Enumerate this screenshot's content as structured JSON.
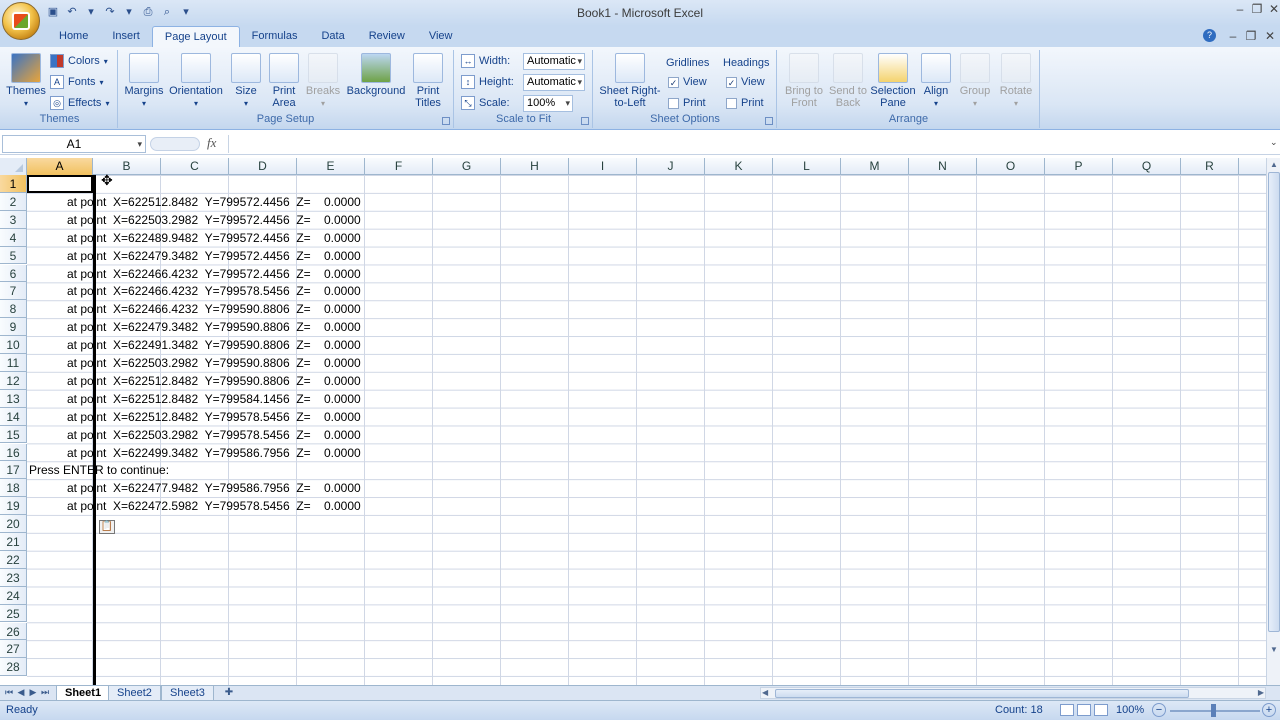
{
  "window": {
    "title": "Book1 - Microsoft Excel"
  },
  "quick_access": [
    {
      "icon": "save-icon",
      "glyph": "▣"
    },
    {
      "icon": "undo-icon",
      "glyph": "↶"
    },
    {
      "icon": "undo-dropdown-icon",
      "glyph": "▾"
    },
    {
      "icon": "redo-icon",
      "glyph": "↷"
    },
    {
      "icon": "redo-dropdown-icon",
      "glyph": "▾"
    },
    {
      "icon": "print-icon",
      "glyph": "⎙"
    },
    {
      "icon": "print-preview-icon",
      "glyph": "⌕"
    },
    {
      "icon": "customize-qat-icon",
      "glyph": "▾"
    }
  ],
  "tabs": [
    "Home",
    "Insert",
    "Page Layout",
    "Formulas",
    "Data",
    "Review",
    "View"
  ],
  "active_tab": "Page Layout",
  "ribbon": {
    "themes": {
      "label": "Themes",
      "themes_btn": "Themes",
      "colors": "Colors",
      "fonts": "Fonts",
      "effects": "Effects"
    },
    "page_setup": {
      "label": "Page Setup",
      "margins": "Margins",
      "orientation": "Orientation",
      "size": "Size",
      "print_area": "Print Area",
      "breaks": "Breaks",
      "background": "Background",
      "print_titles": "Print Titles"
    },
    "scale_to_fit": {
      "label": "Scale to Fit",
      "width_label": "Width:",
      "width_value": "Automatic",
      "height_label": "Height:",
      "height_value": "Automatic",
      "scale_label": "Scale:",
      "scale_value": "100%"
    },
    "sheet_options": {
      "label": "Sheet Options",
      "sheet_rtl": "Sheet Right-to-Left",
      "gridlines": "Gridlines",
      "headings": "Headings",
      "view": "View",
      "print": "Print"
    },
    "arrange": {
      "label": "Arrange",
      "bring_to_front": "Bring to Front",
      "send_to_back": "Send to Back",
      "selection_pane": "Selection Pane",
      "align": "Align",
      "group": "Group",
      "rotate": "Rotate"
    }
  },
  "formula_bar": {
    "name_box": "A1",
    "fx": "fx",
    "value": ""
  },
  "columns": [
    "A",
    "B",
    "C",
    "D",
    "E",
    "F",
    "G",
    "H",
    "I",
    "J",
    "K",
    "L",
    "M",
    "N",
    "O",
    "P",
    "Q",
    "R"
  ],
  "rows": [
    "1",
    "2",
    "3",
    "4",
    "5",
    "6",
    "7",
    "8",
    "9",
    "10",
    "11",
    "12",
    "13",
    "14",
    "15",
    "16",
    "17",
    "18",
    "19",
    "20",
    "21",
    "22",
    "23",
    "24",
    "25",
    "26",
    "27",
    "28"
  ],
  "selected_cell": {
    "col": "A",
    "row": "1"
  },
  "cell_lines": [
    {
      "row": 2,
      "text": "at point  X=622512.8482  Y=799572.4456  Z=    0.0000"
    },
    {
      "row": 3,
      "text": "at point  X=622503.2982  Y=799572.4456  Z=    0.0000"
    },
    {
      "row": 4,
      "text": "at point  X=622489.9482  Y=799572.4456  Z=    0.0000"
    },
    {
      "row": 5,
      "text": "at point  X=622479.3482  Y=799572.4456  Z=    0.0000"
    },
    {
      "row": 6,
      "text": "at point  X=622466.4232  Y=799572.4456  Z=    0.0000"
    },
    {
      "row": 7,
      "text": "at point  X=622466.4232  Y=799578.5456  Z=    0.0000"
    },
    {
      "row": 8,
      "text": "at point  X=622466.4232  Y=799590.8806  Z=    0.0000"
    },
    {
      "row": 9,
      "text": "at point  X=622479.3482  Y=799590.8806  Z=    0.0000"
    },
    {
      "row": 10,
      "text": "at point  X=622491.3482  Y=799590.8806  Z=    0.0000"
    },
    {
      "row": 11,
      "text": "at point  X=622503.2982  Y=799590.8806  Z=    0.0000"
    },
    {
      "row": 12,
      "text": "at point  X=622512.8482  Y=799590.8806  Z=    0.0000"
    },
    {
      "row": 13,
      "text": "at point  X=622512.8482  Y=799584.1456  Z=    0.0000"
    },
    {
      "row": 14,
      "text": "at point  X=622512.8482  Y=799578.5456  Z=    0.0000"
    },
    {
      "row": 15,
      "text": "at point  X=622503.2982  Y=799578.5456  Z=    0.0000"
    },
    {
      "row": 16,
      "text": "at point  X=622499.3482  Y=799586.7956  Z=    0.0000"
    },
    {
      "row": 17,
      "text": "Press ENTER to continue:"
    },
    {
      "row": 18,
      "text": "at point  X=622477.9482  Y=799586.7956  Z=    0.0000"
    },
    {
      "row": 19,
      "text": "at point  X=622472.5982  Y=799578.5456  Z=    0.0000"
    }
  ],
  "sheets": [
    "Sheet1",
    "Sheet2",
    "Sheet3"
  ],
  "active_sheet": "Sheet1",
  "status": {
    "ready": "Ready",
    "count": "Count: 18",
    "zoom": "100%"
  }
}
